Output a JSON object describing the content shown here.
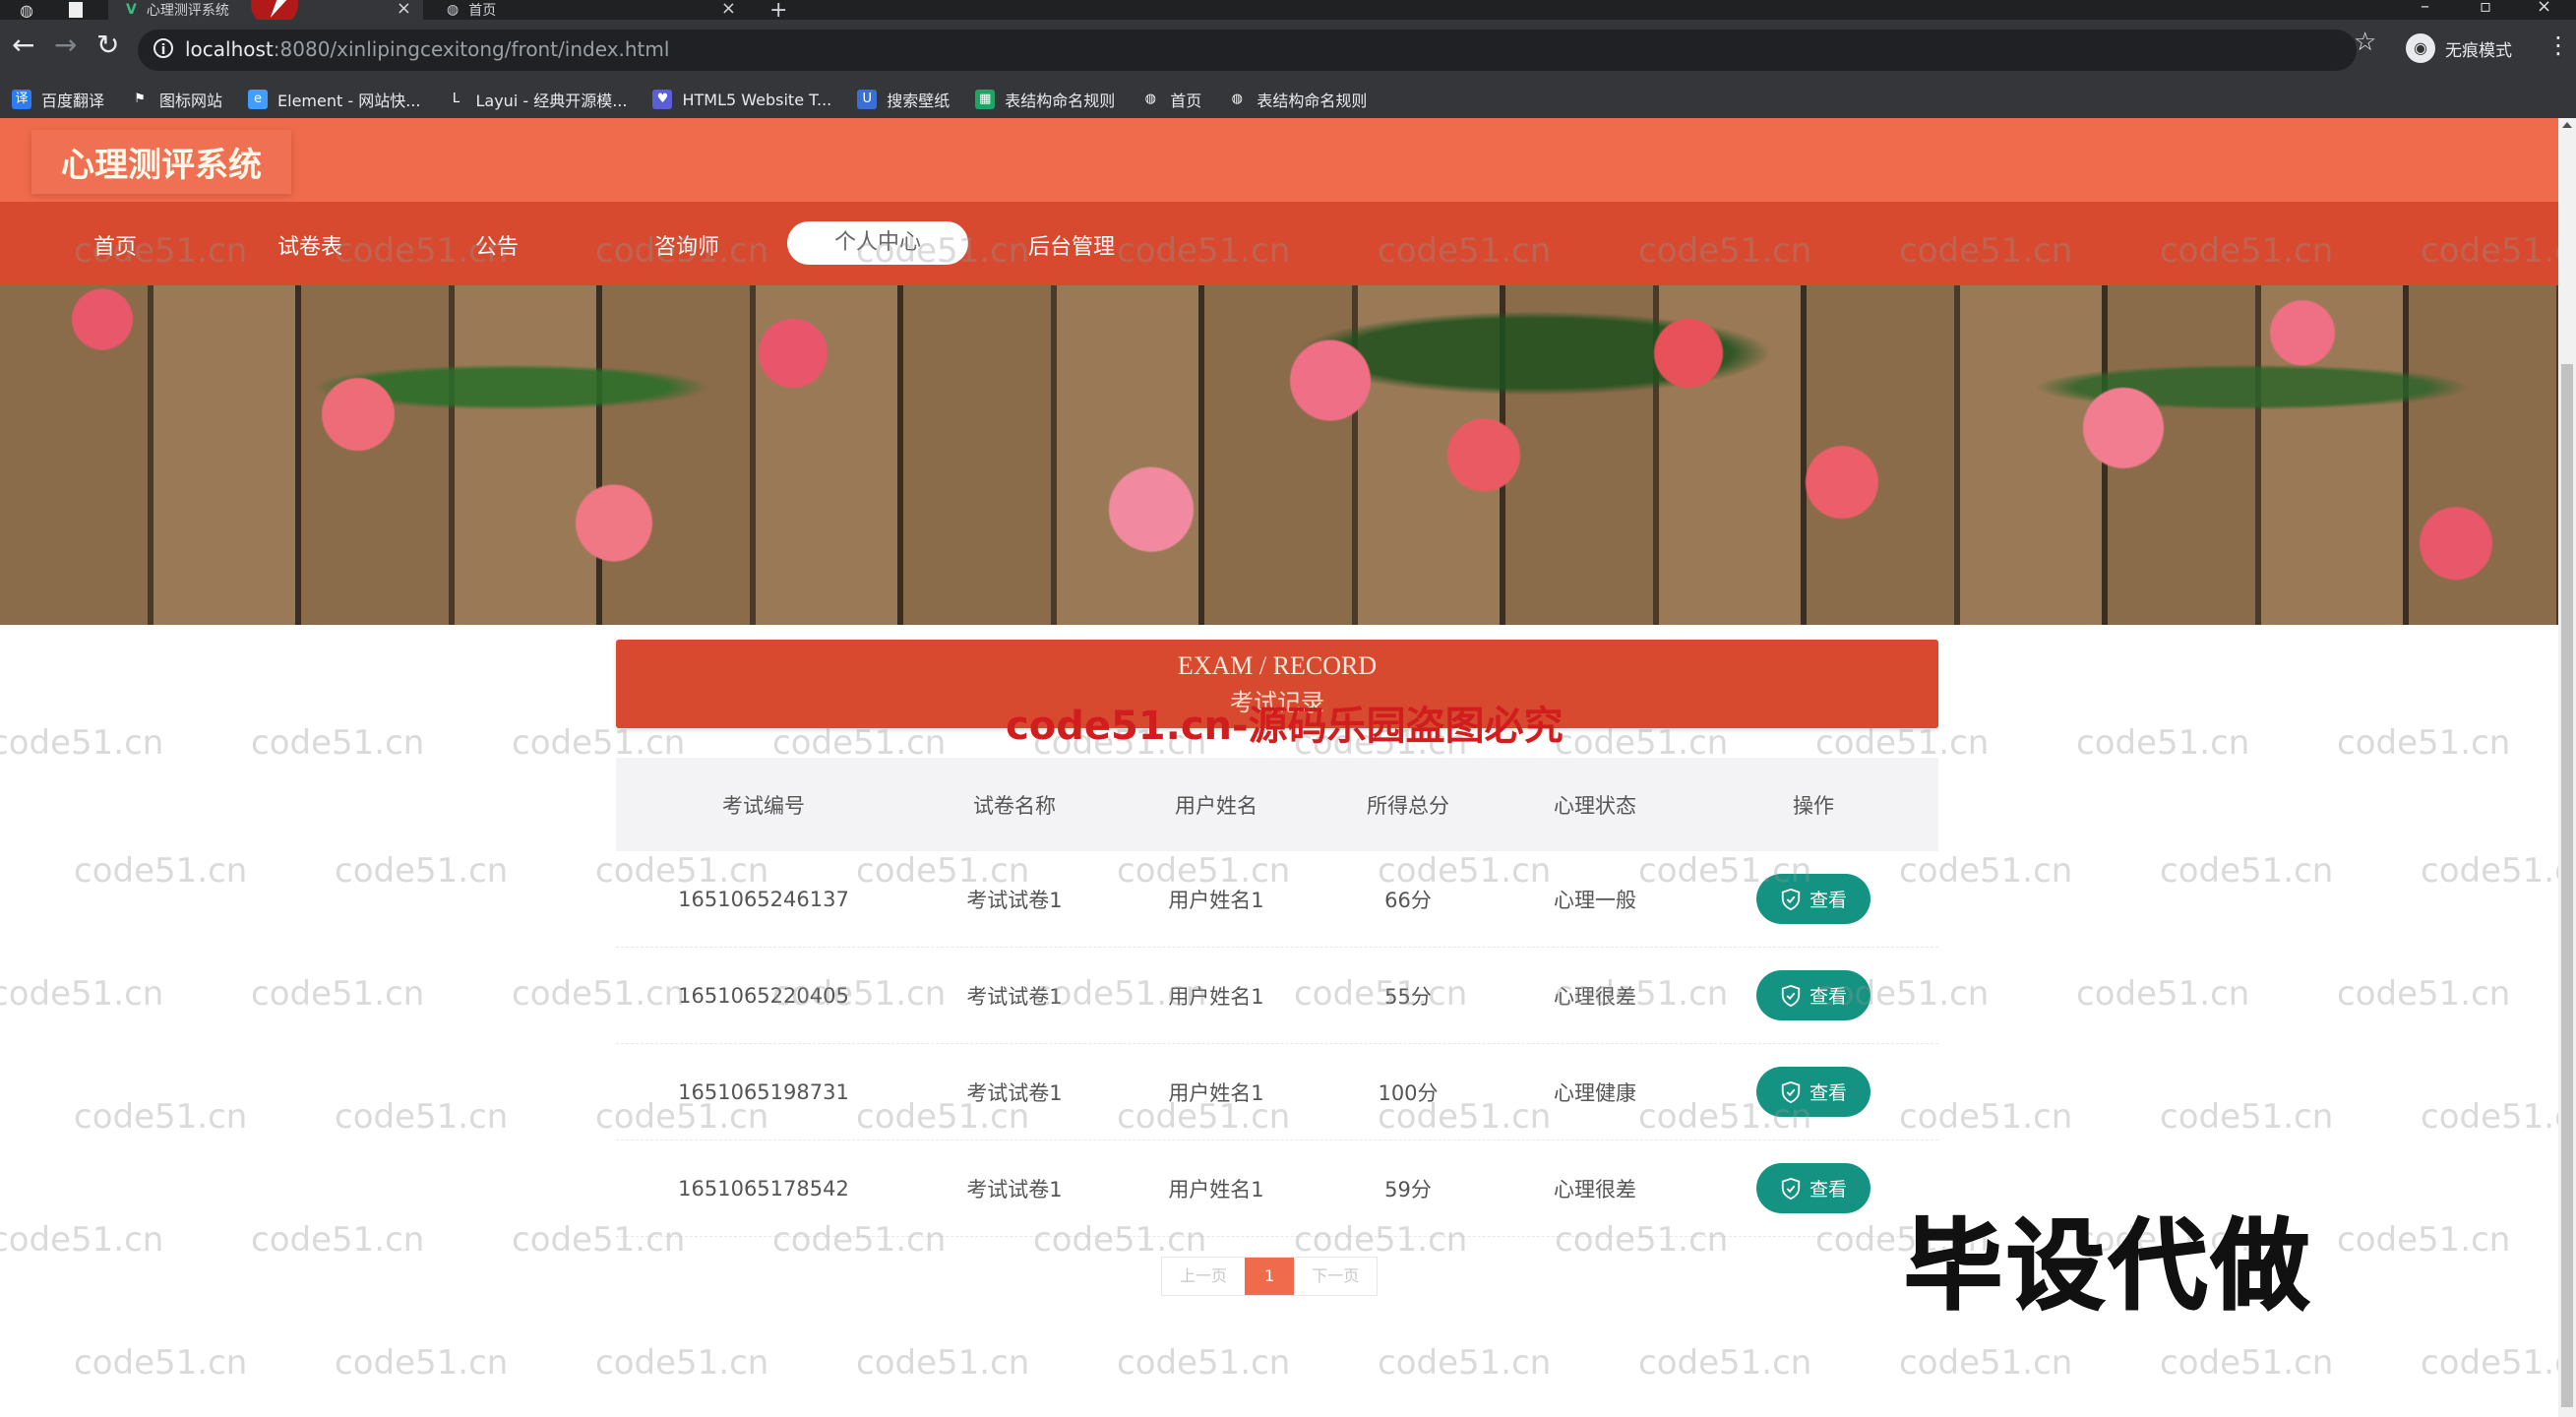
{
  "browser": {
    "tabs": [
      {
        "title": "心理测评系统",
        "active": true
      },
      {
        "title": "首页",
        "active": false
      }
    ],
    "new_tab": "+",
    "close": "×",
    "url_host": "localhost",
    "url_rest": ":8080/xinlipingcexitong/front/index.html",
    "incognito_label": "无痕模式",
    "bookmarks": [
      {
        "label": "百度翻译",
        "icon": "translate-icon",
        "color": "#2b7cf6",
        "glyph": "译"
      },
      {
        "label": "图标网站",
        "icon": "flag-icon",
        "color": "#35363a",
        "glyph": "⚑"
      },
      {
        "label": "Element - 网站快...",
        "icon": "element-icon",
        "color": "#409eff",
        "glyph": "e"
      },
      {
        "label": "Layui - 经典开源模...",
        "icon": "layui-icon",
        "color": "#35363a",
        "glyph": "L"
      },
      {
        "label": "HTML5 Website T...",
        "icon": "html5-icon",
        "color": "#5b5fd6",
        "glyph": "♥"
      },
      {
        "label": "搜索壁纸",
        "icon": "wallpaper-icon",
        "color": "#3a6fd8",
        "glyph": "U"
      },
      {
        "label": "表结构命名规则",
        "icon": "sheet-icon",
        "color": "#1fa463",
        "glyph": "▦"
      },
      {
        "label": "首页",
        "icon": "globe-icon",
        "color": "#35363a",
        "glyph": "◍"
      },
      {
        "label": "表结构命名规则",
        "icon": "globe-icon",
        "color": "#35363a",
        "glyph": "◍"
      }
    ]
  },
  "site": {
    "title": "心理测评系统",
    "nav": [
      {
        "label": "首页",
        "active": false
      },
      {
        "label": "试卷表",
        "active": false
      },
      {
        "label": "公告",
        "active": false
      },
      {
        "label": "咨询师",
        "active": false
      },
      {
        "label": "个人中心",
        "active": true
      },
      {
        "label": "后台管理",
        "active": false
      }
    ],
    "banner": {
      "slide_count": 3,
      "active_slide": 3
    }
  },
  "record": {
    "title_en": "EXAM / RECORD",
    "title_cn": "考试记录",
    "columns": [
      "考试编号",
      "试卷名称",
      "用户姓名",
      "所得总分",
      "心理状态",
      "操作"
    ],
    "rows": [
      {
        "id": "1651065246137",
        "paper": "考试试卷1",
        "user": "用户姓名1",
        "score": "66分",
        "state": "心理一般",
        "action": "查看"
      },
      {
        "id": "1651065220405",
        "paper": "考试试卷1",
        "user": "用户姓名1",
        "score": "55分",
        "state": "心理很差",
        "action": "查看"
      },
      {
        "id": "1651065198731",
        "paper": "考试试卷1",
        "user": "用户姓名1",
        "score": "100分",
        "state": "心理健康",
        "action": "查看"
      },
      {
        "id": "1651065178542",
        "paper": "考试试卷1",
        "user": "用户姓名1",
        "score": "59分",
        "state": "心理很差",
        "action": "查看"
      }
    ]
  },
  "pagination": {
    "prev": "上一页",
    "current": "1",
    "next": "下一页"
  },
  "overlays": {
    "watermark": "code51.cn",
    "red_watermark": "code51.cn-源码乐园盗图必究",
    "promo": "毕设代做"
  },
  "colors": {
    "header": "#ef6b4c",
    "nav": "#d74a2f",
    "view_button": "#159382"
  }
}
